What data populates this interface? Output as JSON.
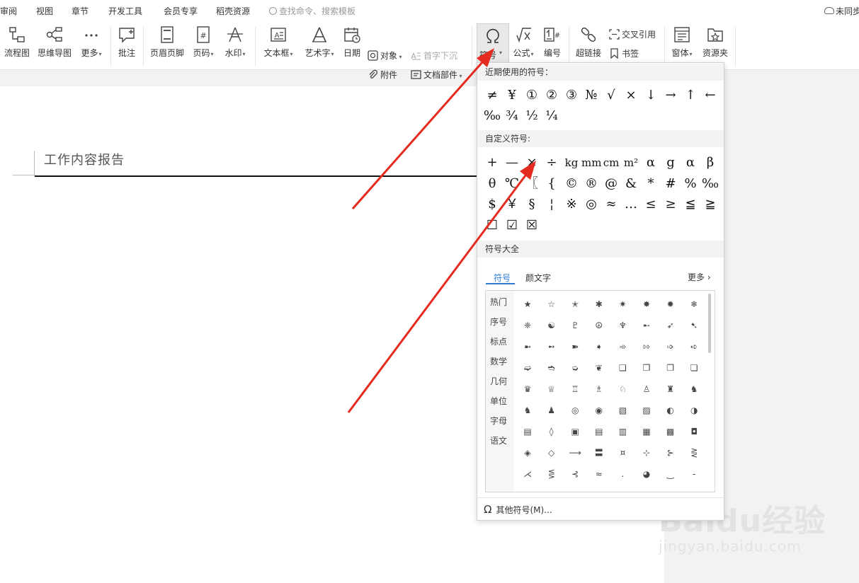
{
  "menu": {
    "items": [
      "审阅",
      "视图",
      "章节",
      "开发工具",
      "会员专享",
      "稻壳资源"
    ],
    "search_placeholder": "查找命令、搜索模板",
    "sync_label": "未同步"
  },
  "toolbar": {
    "flowchart": "流程图",
    "mindmap": "思维导图",
    "more": "更多",
    "comment": "批注",
    "header_footer": "页眉页脚",
    "page_number": "页码",
    "watermark": "水印",
    "textbox": "文本框",
    "wordart": "艺术字",
    "date": "日期",
    "object": "对象",
    "attachment": "附件",
    "dropcap": "首字下沉",
    "doc_parts": "文档部件",
    "symbol": "符号",
    "formula": "公式",
    "numbering": "编号",
    "hyperlink": "超链接",
    "cross_ref": "交叉引用",
    "bookmark": "书签",
    "window": "窗体",
    "resources": "资源夹"
  },
  "document": {
    "title": "工作内容报告"
  },
  "symbol_panel": {
    "recent_title": "近期使用的符号：",
    "recent": [
      "≠",
      "¥",
      "①",
      "②",
      "③",
      "№",
      "√",
      "×",
      "↓",
      "→",
      "↑",
      "←",
      "‰",
      "¾",
      "½",
      "¼"
    ],
    "custom_title": "自定义符号:",
    "custom": [
      "+",
      "—",
      "×",
      "÷",
      "kg",
      "mm",
      "cm",
      "m²",
      "α",
      "g",
      "α",
      "β",
      "θ",
      "℃",
      "〖",
      "{",
      "©",
      "®",
      "@",
      "&",
      "*",
      "#",
      "%",
      "‰",
      "$",
      "￥",
      "§",
      "¦",
      "※",
      "◎",
      "≈",
      "…",
      "≤",
      "≥",
      "≦",
      "≧",
      "☐",
      "☑",
      "☒"
    ],
    "all_title": "符号大全",
    "tabs": [
      "符号",
      "颜文字"
    ],
    "more_label": "更多",
    "categories": [
      "热门",
      "序号",
      "标点",
      "数学",
      "几何",
      "单位",
      "字母",
      "语文"
    ],
    "symbols": [
      "★",
      "☆",
      "✭",
      "✱",
      "✷",
      "✸",
      "✹",
      "❄",
      "❈",
      "☯",
      "♇",
      "☮",
      "♆",
      "➸",
      "➶",
      "➷",
      "➼",
      "➻",
      "➽",
      "➧",
      "➾",
      "⇰",
      "➩",
      "➪",
      "➫",
      "➬",
      "➭",
      "❦",
      "❑",
      "❒",
      "❐",
      "❏",
      "♛",
      "♕",
      "♖",
      "♗",
      "♘",
      "♙",
      "♜",
      "♞",
      "♞",
      "♟",
      "◎",
      "◉",
      "▧",
      "▨",
      "◐",
      "◑",
      "▤",
      "◊",
      "▣",
      "▤",
      "▥",
      "▦",
      "▩",
      "◘",
      "◈",
      "◇",
      "⟶",
      "〓",
      "¤",
      "⊹",
      "⊱",
      "⋛",
      "⋌",
      "⋚",
      "⊰",
      "≈",
      ".",
      "◕",
      "‿",
      "-"
    ],
    "footer_label": "其他符号(M)..."
  },
  "watermark": {
    "logo": "Baidu经验",
    "url": "jingyan.baidu.com"
  },
  "colors": {
    "accent": "#2f7cd7",
    "arrow": "#e52b1f"
  }
}
